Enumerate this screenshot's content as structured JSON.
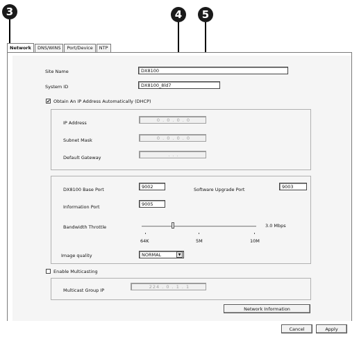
{
  "callouts": {
    "c3": "3",
    "c4": "4",
    "c5": "5"
  },
  "tabs": [
    {
      "label": "Network"
    },
    {
      "label": "DNS/WINS"
    },
    {
      "label": "Port/Device"
    },
    {
      "label": "NTP"
    }
  ],
  "general": {
    "site_name_label": "Site Name",
    "site_name_value": "DX8100",
    "system_id_label": "System ID",
    "system_id_value": "DX8100_8ld7"
  },
  "dhcp": {
    "checked": true,
    "label": "Obtain An IP Address Automatically (DHCP)",
    "ip_label": "IP Address",
    "ip_value": "0 . 0 . 0 . 0",
    "subnet_label": "Subnet Mask",
    "subnet_value": "0 . 0 . 0 . 0",
    "gateway_label": "Default Gateway",
    "gateway_value": ". . ."
  },
  "ports": {
    "base_port_label": "DX8100 Base Port",
    "base_port_value": "9002",
    "upgrade_port_label": "Software Upgrade Port",
    "upgrade_port_value": "9003",
    "info_port_label": "Information Port",
    "info_port_value": "9005",
    "bandwidth_label": "Bandwidth Throttle",
    "bandwidth_value": "3.0 Mbps",
    "bandwidth_level": 0.27,
    "tick_64k": "64K",
    "tick_5m": "5M",
    "tick_10m": "10M",
    "quality_label": "Image quality",
    "quality_value": "NORMAL"
  },
  "multicast": {
    "checked": false,
    "label": "Enable Multicasting",
    "group_ip_label": "Multicast Group IP",
    "group_ip_value": "224 . 0 . 1 . 1"
  },
  "buttons": {
    "network_info": "Network Information",
    "cancel": "Cancel",
    "apply": "Apply"
  },
  "icons": {
    "checked_glyph": "✔",
    "dropdown": "chevron-down-icon"
  }
}
